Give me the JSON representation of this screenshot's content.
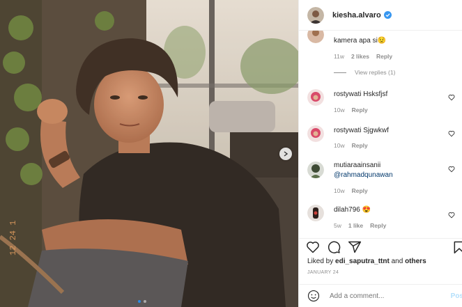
{
  "post": {
    "author": "kiesha.alvaro",
    "verified": true,
    "carousel": {
      "count": 2,
      "active_index": 0
    }
  },
  "comments": [
    {
      "username": "",
      "text": "kamera apa si",
      "emoji": "😟",
      "time": "11w",
      "likes": "2 likes",
      "reply": "Reply",
      "view_replies": "View replies (1)"
    },
    {
      "username": "rostywati",
      "text": "Hsksfjsf",
      "time": "10w",
      "reply": "Reply"
    },
    {
      "username": "rostywati",
      "text": "Sjgwkwf",
      "time": "10w",
      "reply": "Reply"
    },
    {
      "username": "mutiaraainsanii",
      "text": "@rahmadqunawan",
      "time": "10w",
      "reply": "Reply"
    },
    {
      "username": "dilah796",
      "text": "",
      "emoji": "😍",
      "time": "5w",
      "likes": "1 like",
      "reply": "Reply"
    }
  ],
  "likes": {
    "prefix": "Liked by",
    "user": "edi_saputra_ttnt",
    "and": "and",
    "others": "others"
  },
  "date": "JANUARY 24",
  "add_comment": {
    "placeholder": "Add a comment...",
    "post_label": "Pos"
  },
  "colors": {
    "link": "#00376b",
    "verified": "#3897f0",
    "muted": "#8e8e8e",
    "post_disabled": "#b2dffc"
  },
  "icons": [
    "heart-icon",
    "comment-icon",
    "share-icon",
    "bookmark-icon",
    "emoji-icon",
    "verified-badge-icon",
    "chevron-right-icon"
  ]
}
